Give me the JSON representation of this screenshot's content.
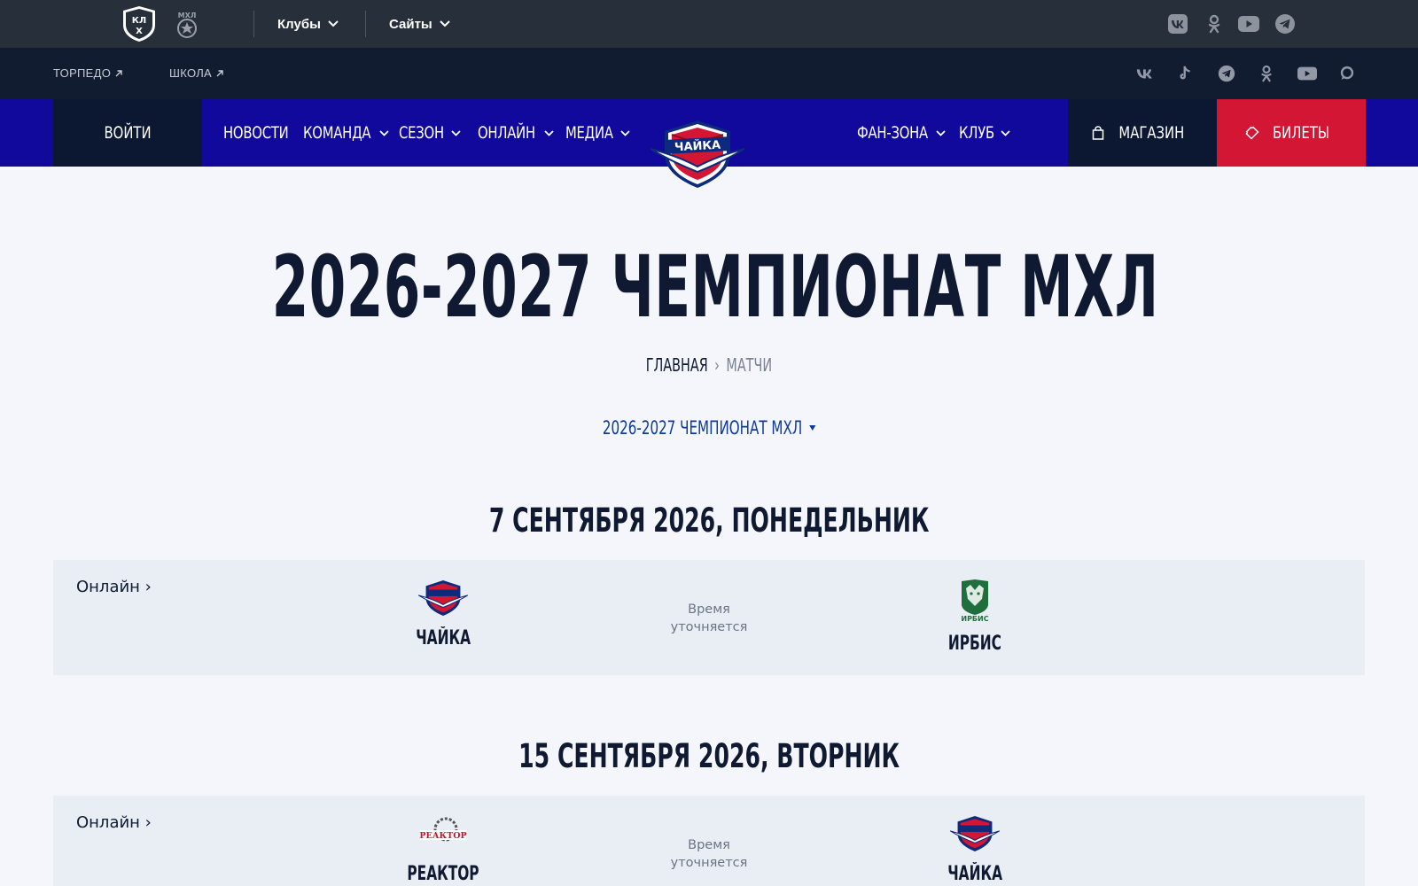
{
  "topbar": {
    "logos": [
      "khl-logo",
      "mhl-logo"
    ],
    "clubs_label": "Клубы",
    "sites_label": "Сайты",
    "social_icons": [
      "vk-icon",
      "ok-icon",
      "youtube-icon",
      "telegram-icon"
    ]
  },
  "subbar": {
    "links": [
      "ТОРПЕДО",
      "ШКОЛА"
    ],
    "social_icons": [
      "vk-icon",
      "tiktok-icon",
      "telegram-icon",
      "ok-icon",
      "youtube-icon",
      "max-icon"
    ]
  },
  "nav": {
    "login": "ВОЙТИ",
    "items": [
      "НОВОСТИ",
      "КОМАНДА",
      "СЕЗОН",
      "ОНЛАЙН",
      "МЕДИА",
      "ФАН-ЗОНА",
      "КЛУБ"
    ],
    "shop": "МАГАЗИН",
    "tickets": "БИЛЕТЫ",
    "club_logo_text": "ЧАЙКА"
  },
  "page": {
    "title": "2026-2027 ЧЕМПИОНАТ МХЛ",
    "breadcrumb": {
      "home": "ГЛАВНАЯ",
      "separator": "›",
      "current": "МАТЧИ"
    },
    "season_select": "2026-2027 ЧЕМПИОНАТ МХЛ"
  },
  "matches": [
    {
      "date": "7 СЕНТЯБРЯ 2026, ПОНЕДЕЛЬНИК",
      "online": "Онлайн ›",
      "home": "ЧАЙКА",
      "away": "ИРБИС",
      "time_line1": "Время",
      "time_line2": "уточняется",
      "away_logo_text": "ИРБИС"
    },
    {
      "date": "15 СЕНТЯБРЯ 2026, ВТОРНИК",
      "online": "Онлайн ›",
      "home": "РЕАКТОР",
      "away": "ЧАЙКА",
      "time_line1": "Время",
      "time_line2": "уточняется",
      "home_logo_text": "РЕАКТОР"
    }
  ],
  "colors": {
    "topbar": "#262f3a",
    "subbar": "#111c31",
    "nav": "#11099c",
    "dark_block": "#0c1832",
    "tickets": "#d31634",
    "accent_blue": "#0d3a9b",
    "background": "#f4f6fb"
  }
}
